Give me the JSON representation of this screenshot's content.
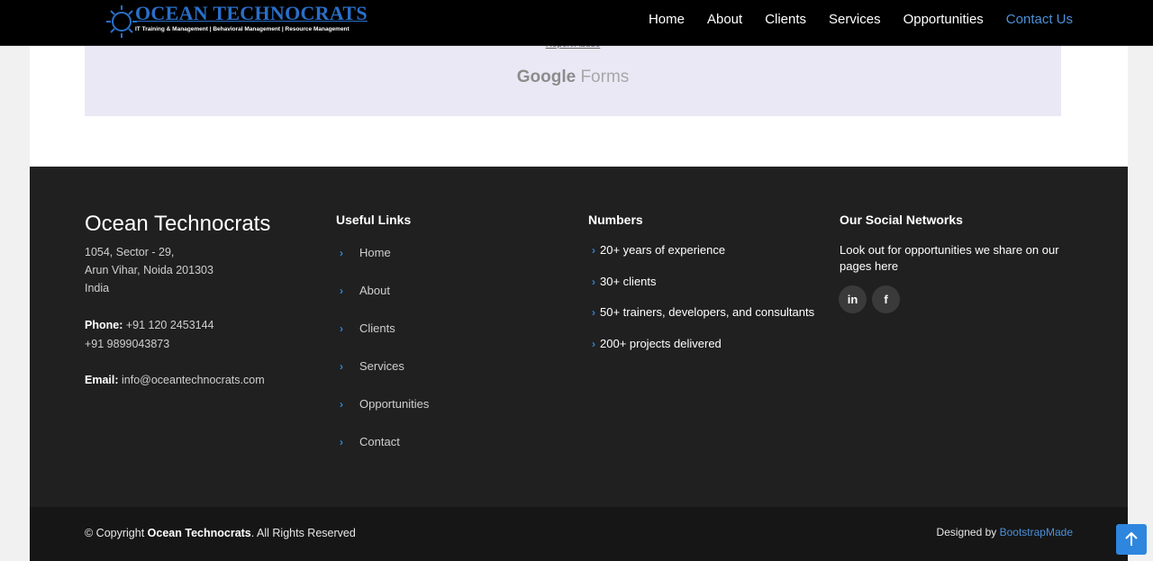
{
  "header": {
    "logo_title": "OCEAN TECHNOCRATS",
    "logo_tagline": "IT Training & Management | Behavioral Management | Resource Management",
    "nav": [
      "Home",
      "About",
      "Clients",
      "Services",
      "Opportunities",
      "Contact Us"
    ],
    "active_nav": "Contact Us"
  },
  "form_embed": {
    "report_abuse": "Report Abuse",
    "google_word": "Google",
    "forms_word": "Forms"
  },
  "footer": {
    "brand": "Ocean Technocrats",
    "address_line1": "1054, Sector - 29,",
    "address_line2": "Arun Vihar, Noida 201303",
    "address_line3": "India",
    "phone_label": "Phone:",
    "phone1": "+91 120 2453144",
    "phone2": "+91 9899043873",
    "email_label": "Email:",
    "email": "info@oceantechnocrats.com",
    "useful_links_title": "Useful Links",
    "useful_links": [
      "Home",
      "About",
      "Clients",
      "Services",
      "Opportunities",
      "Contact"
    ],
    "numbers_title": "Numbers",
    "numbers": [
      "20+ years of experience",
      "30+ clients",
      "50+ trainers, developers, and consultants",
      "200+ projects delivered"
    ],
    "social_title": "Our Social Networks",
    "social_text": "Look out for opportunities we share on our pages here",
    "social_icons": [
      "linkedin-icon",
      "facebook-icon"
    ],
    "social_glyphs": [
      "in",
      "f"
    ]
  },
  "bottom": {
    "copyright_prefix": "© Copyright",
    "copyright_brand": "Ocean Technocrats",
    "copyright_suffix": ". All Rights Reserved",
    "designed_by": "Designed by",
    "designer": "BootstrapMade"
  },
  "colors": {
    "accent": "#2e86de",
    "header_bg": "#000000",
    "footer_bg": "#202020",
    "footer_bottom_bg": "#161616",
    "form_bg": "#ebe8f6"
  }
}
